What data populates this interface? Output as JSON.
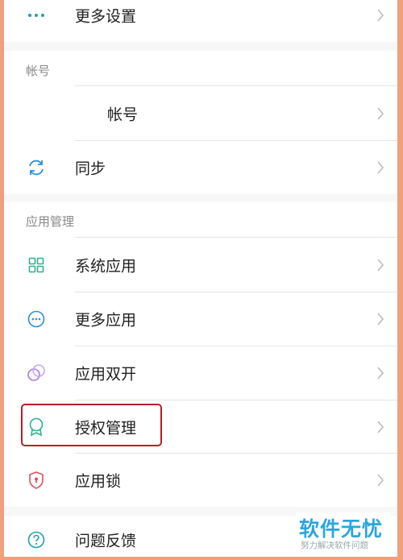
{
  "more_settings": {
    "label": "更多设置",
    "icon": "more-dots-icon"
  },
  "account_section": {
    "header": "帐号",
    "items": [
      {
        "label": "帐号",
        "icon": ""
      },
      {
        "label": "同步",
        "icon": "sync-icon"
      }
    ]
  },
  "app_section": {
    "header": "应用管理",
    "items": [
      {
        "label": "系统应用",
        "icon": "grid-icon"
      },
      {
        "label": "更多应用",
        "icon": "more-circle-icon"
      },
      {
        "label": "应用双开",
        "icon": "dual-circle-icon"
      },
      {
        "label": "授权管理",
        "icon": "badge-icon"
      },
      {
        "label": "应用锁",
        "icon": "shield-lock-icon"
      }
    ]
  },
  "feedback": {
    "label": "问题反馈",
    "icon": "question-icon"
  },
  "watermark": {
    "title": "软件无忧",
    "subtitle": "努力解决软件问题"
  },
  "colors": {
    "accent": "#21a0a8",
    "highlight_border": "#b81d2c",
    "watermark": "#2aa6e0"
  }
}
